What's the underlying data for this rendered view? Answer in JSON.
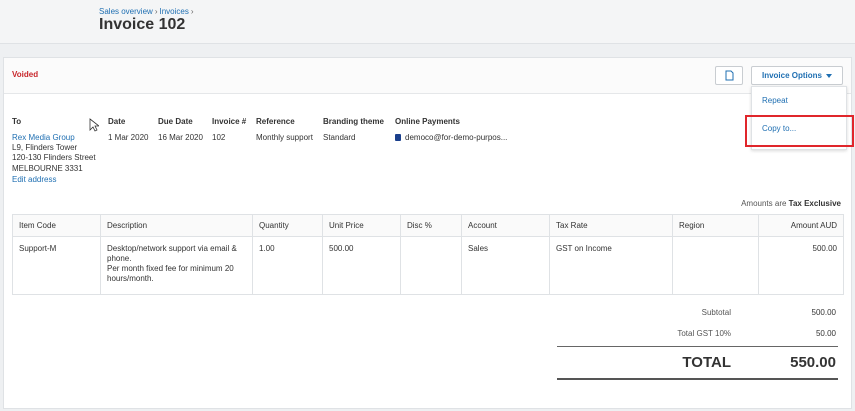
{
  "breadcrumb": {
    "item1": "Sales overview",
    "item2": "Invoices",
    "sep": "›"
  },
  "page_title": "Invoice 102",
  "status": {
    "label": "Voided",
    "color": "#c8262b"
  },
  "toolbar": {
    "doc_icon": "document-icon",
    "options_label": "Invoice Options"
  },
  "dropdown": {
    "items": [
      "Repeat",
      "Copy to..."
    ]
  },
  "details": {
    "to_label": "To",
    "to_name": "Rex Media Group",
    "to_address": [
      "L9, Flinders Tower",
      "120-130 Flinders Street",
      "MELBOURNE 3331"
    ],
    "edit_address": "Edit address",
    "date_label": "Date",
    "date": "1 Mar 2020",
    "due_label": "Due Date",
    "due": "16 Mar 2020",
    "invoice_label": "Invoice #",
    "invoice": "102",
    "ref_label": "Reference",
    "ref": "Monthly support",
    "brand_label": "Branding theme",
    "brand": "Standard",
    "online_label": "Online Payments",
    "online": "democo@for-demo-purpos..."
  },
  "amounts_note": {
    "prefix": "Amounts are",
    "value": "Tax Exclusive"
  },
  "table": {
    "headers": [
      "Item Code",
      "Description",
      "Quantity",
      "Unit Price",
      "Disc %",
      "Account",
      "Tax Rate",
      "Region",
      "Amount AUD"
    ],
    "row": {
      "item_code": "Support-M",
      "description_1": "Desktop/network support via email & phone.",
      "description_2": "Per month fixed fee for minimum 20 hours/month.",
      "quantity": "1.00",
      "unit_price": "500.00",
      "disc": "",
      "account": "Sales",
      "tax_rate": "GST on Income",
      "region": "",
      "amount": "500.00"
    }
  },
  "totals": {
    "subtotal_label": "Subtotal",
    "subtotal": "500.00",
    "gst_label": "Total GST  10%",
    "gst": "50.00",
    "total_label": "TOTAL",
    "total": "550.00"
  }
}
